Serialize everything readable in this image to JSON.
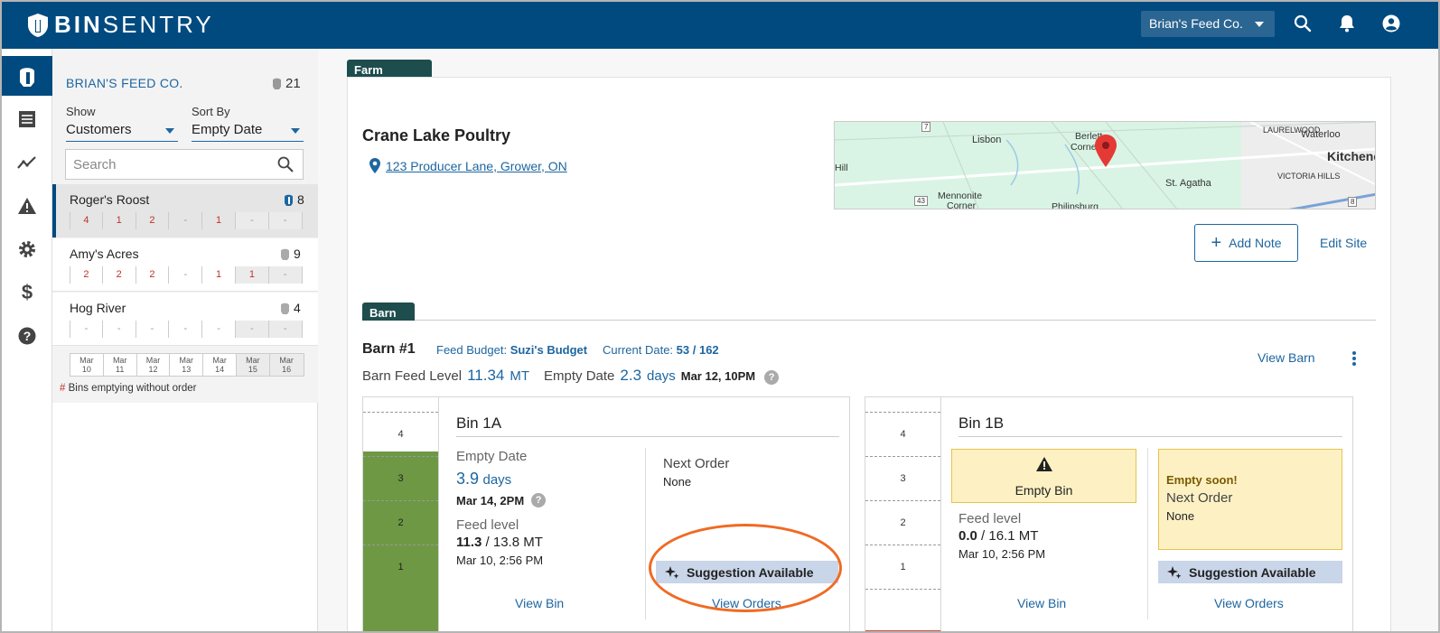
{
  "header": {
    "logo_bold": "BIN",
    "logo_light": "SENTRY",
    "account": "Brian's Feed Co."
  },
  "customers_panel": {
    "company": "BRIAN'S FEED CO.",
    "company_count": "21",
    "show_label": "Show",
    "show_value": "Customers",
    "sort_label": "Sort By",
    "sort_value": "Empty Date",
    "search_placeholder": "Search",
    "customers": [
      {
        "name": "Roger's Roost",
        "count": "8",
        "cells": [
          "4",
          "1",
          "2",
          "-",
          "1",
          "-",
          "-"
        ]
      },
      {
        "name": "Amy's Acres",
        "count": "9",
        "cells": [
          "2",
          "2",
          "2",
          "-",
          "1",
          "1",
          "-"
        ]
      },
      {
        "name": "Hog River",
        "count": "4",
        "cells": [
          "-",
          "-",
          "-",
          "-",
          "-",
          "-",
          "-"
        ]
      }
    ],
    "dates": [
      {
        "m": "Mar",
        "d": "10"
      },
      {
        "m": "Mar",
        "d": "11"
      },
      {
        "m": "Mar",
        "d": "12"
      },
      {
        "m": "Mar",
        "d": "13"
      },
      {
        "m": "Mar",
        "d": "14"
      },
      {
        "m": "Mar",
        "d": "15"
      },
      {
        "m": "Mar",
        "d": "16"
      }
    ],
    "legend_hash": "#",
    "legend_text": " Bins emptying without order"
  },
  "farm": {
    "tag": "Farm",
    "name": "Crane Lake Poultry",
    "address": "123 Producer Lane, Grower, ON",
    "map_labels": {
      "lisbon": "Lisbon",
      "berletts": "Berlett",
      "corner": "Corne",
      "laurelwood": "LAURELWOOD",
      "waterloo": "Waterloo",
      "kitchener": "Kitchene",
      "victoria": "VICTORIA HILLS",
      "st_agatha": "St. Agatha",
      "hill": "Hill",
      "mennonite": "Mennonite",
      "mennonite2": "Corner",
      "philipsburg": "Philipsburg",
      "r43": "43",
      "r8": "8",
      "r7": "7"
    },
    "add_note": "Add Note",
    "edit_site": "Edit Site"
  },
  "barn": {
    "tag": "Barn",
    "title": "Barn #1",
    "budget_label": "Feed Budget:",
    "budget_value": "Suzi's Budget",
    "date_label": "Current Date:",
    "date_value": "53 / 162",
    "feed_level_label": "Barn Feed Level",
    "feed_level_value": "11.34",
    "feed_level_unit": "MT",
    "empty_label": "Empty Date",
    "empty_value": "2.3",
    "empty_unit": "days",
    "empty_when": "Mar 12, 10PM",
    "view_barn": "View Barn"
  },
  "bins": [
    {
      "name": "Bin 1A",
      "gauge_rows": [
        "4",
        "3",
        "2",
        "1"
      ],
      "fill_fraction": 0.77,
      "empty_label": "Empty Date",
      "empty_value": "3.9",
      "empty_unit": "days",
      "empty_when": "Mar 14, 2PM",
      "feed_label": "Feed level",
      "feed_value": "11.3",
      "feed_total": " / 13.8 MT",
      "feed_time": "Mar 10, 2:56 PM",
      "next_order_label": "Next Order",
      "next_order_value": "None",
      "suggestion": "Suggestion Available",
      "view_bin": "View Bin",
      "view_orders": "View Orders"
    },
    {
      "name": "Bin 1B",
      "gauge_rows": [
        "4",
        "3",
        "2",
        "1"
      ],
      "fill_fraction": 0,
      "empty_box": "Empty Bin",
      "feed_label": "Feed level",
      "feed_value": "0.0",
      "feed_total": " / 16.1 MT",
      "feed_time": "Mar 10, 2:56 PM",
      "warning": "Empty soon!",
      "next_order_label": "Next Order",
      "next_order_value": "None",
      "suggestion": "Suggestion Available",
      "view_bin": "View Bin",
      "view_orders": "View Orders"
    }
  ],
  "colors": {
    "brand": "#004a7f",
    "link": "#1d66a0",
    "alert_red": "#c03228",
    "fill_green": "#6e9844",
    "highlight": "#f06a23"
  }
}
